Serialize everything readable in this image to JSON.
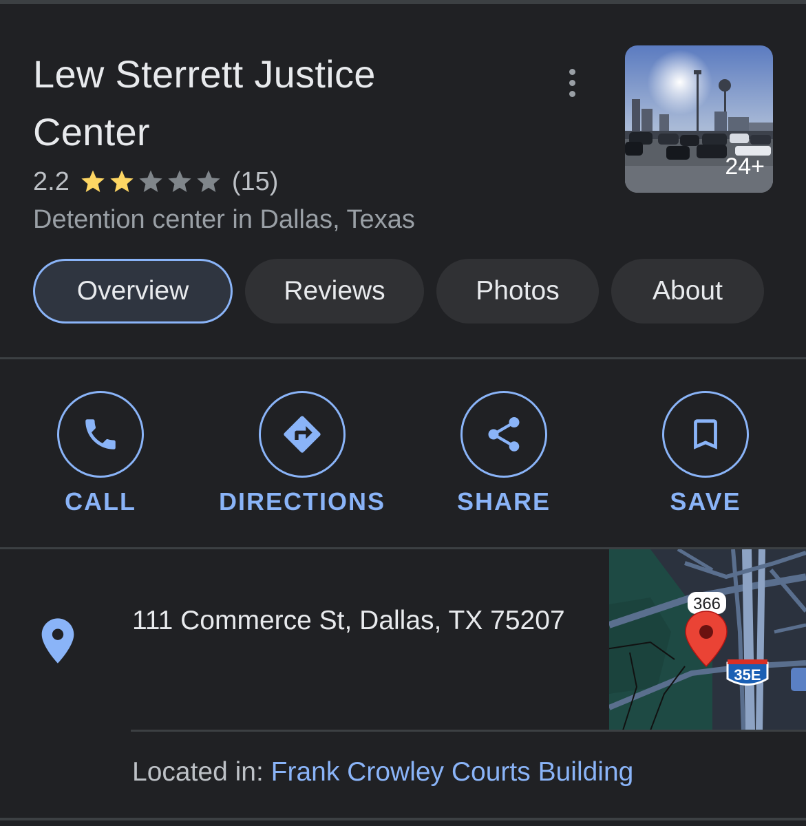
{
  "place": {
    "title": "Lew Sterrett Justice Center",
    "rating": "2.2",
    "rating_value": 2.2,
    "stars_filled": 2,
    "stars_total": 5,
    "review_count": "(15)",
    "category": "Detention center in Dallas, Texas",
    "photo_count": "24+"
  },
  "icons": {
    "more": "more-vert-icon",
    "call": "phone-icon",
    "directions": "directions-icon",
    "share": "share-icon",
    "save": "bookmark-icon",
    "location": "location-pin-icon"
  },
  "tabs": [
    {
      "label": "Overview",
      "active": true
    },
    {
      "label": "Reviews",
      "active": false
    },
    {
      "label": "Photos",
      "active": false
    },
    {
      "label": "About",
      "active": false
    }
  ],
  "actions": [
    {
      "label": "CALL"
    },
    {
      "label": "DIRECTIONS"
    },
    {
      "label": "SHARE"
    },
    {
      "label": "SAVE"
    }
  ],
  "address": {
    "text": "111 Commerce St, Dallas, TX 75207"
  },
  "map": {
    "route_shield": "366",
    "interstate_shield": "35E"
  },
  "located_in": {
    "prefix": "Located in: ",
    "link": "Frank Crowley Courts Building"
  },
  "colors": {
    "background": "#202124",
    "accent": "#8ab4f8",
    "star": "#fdd663",
    "star_empty": "#80868b",
    "pin": "#ea4335"
  }
}
